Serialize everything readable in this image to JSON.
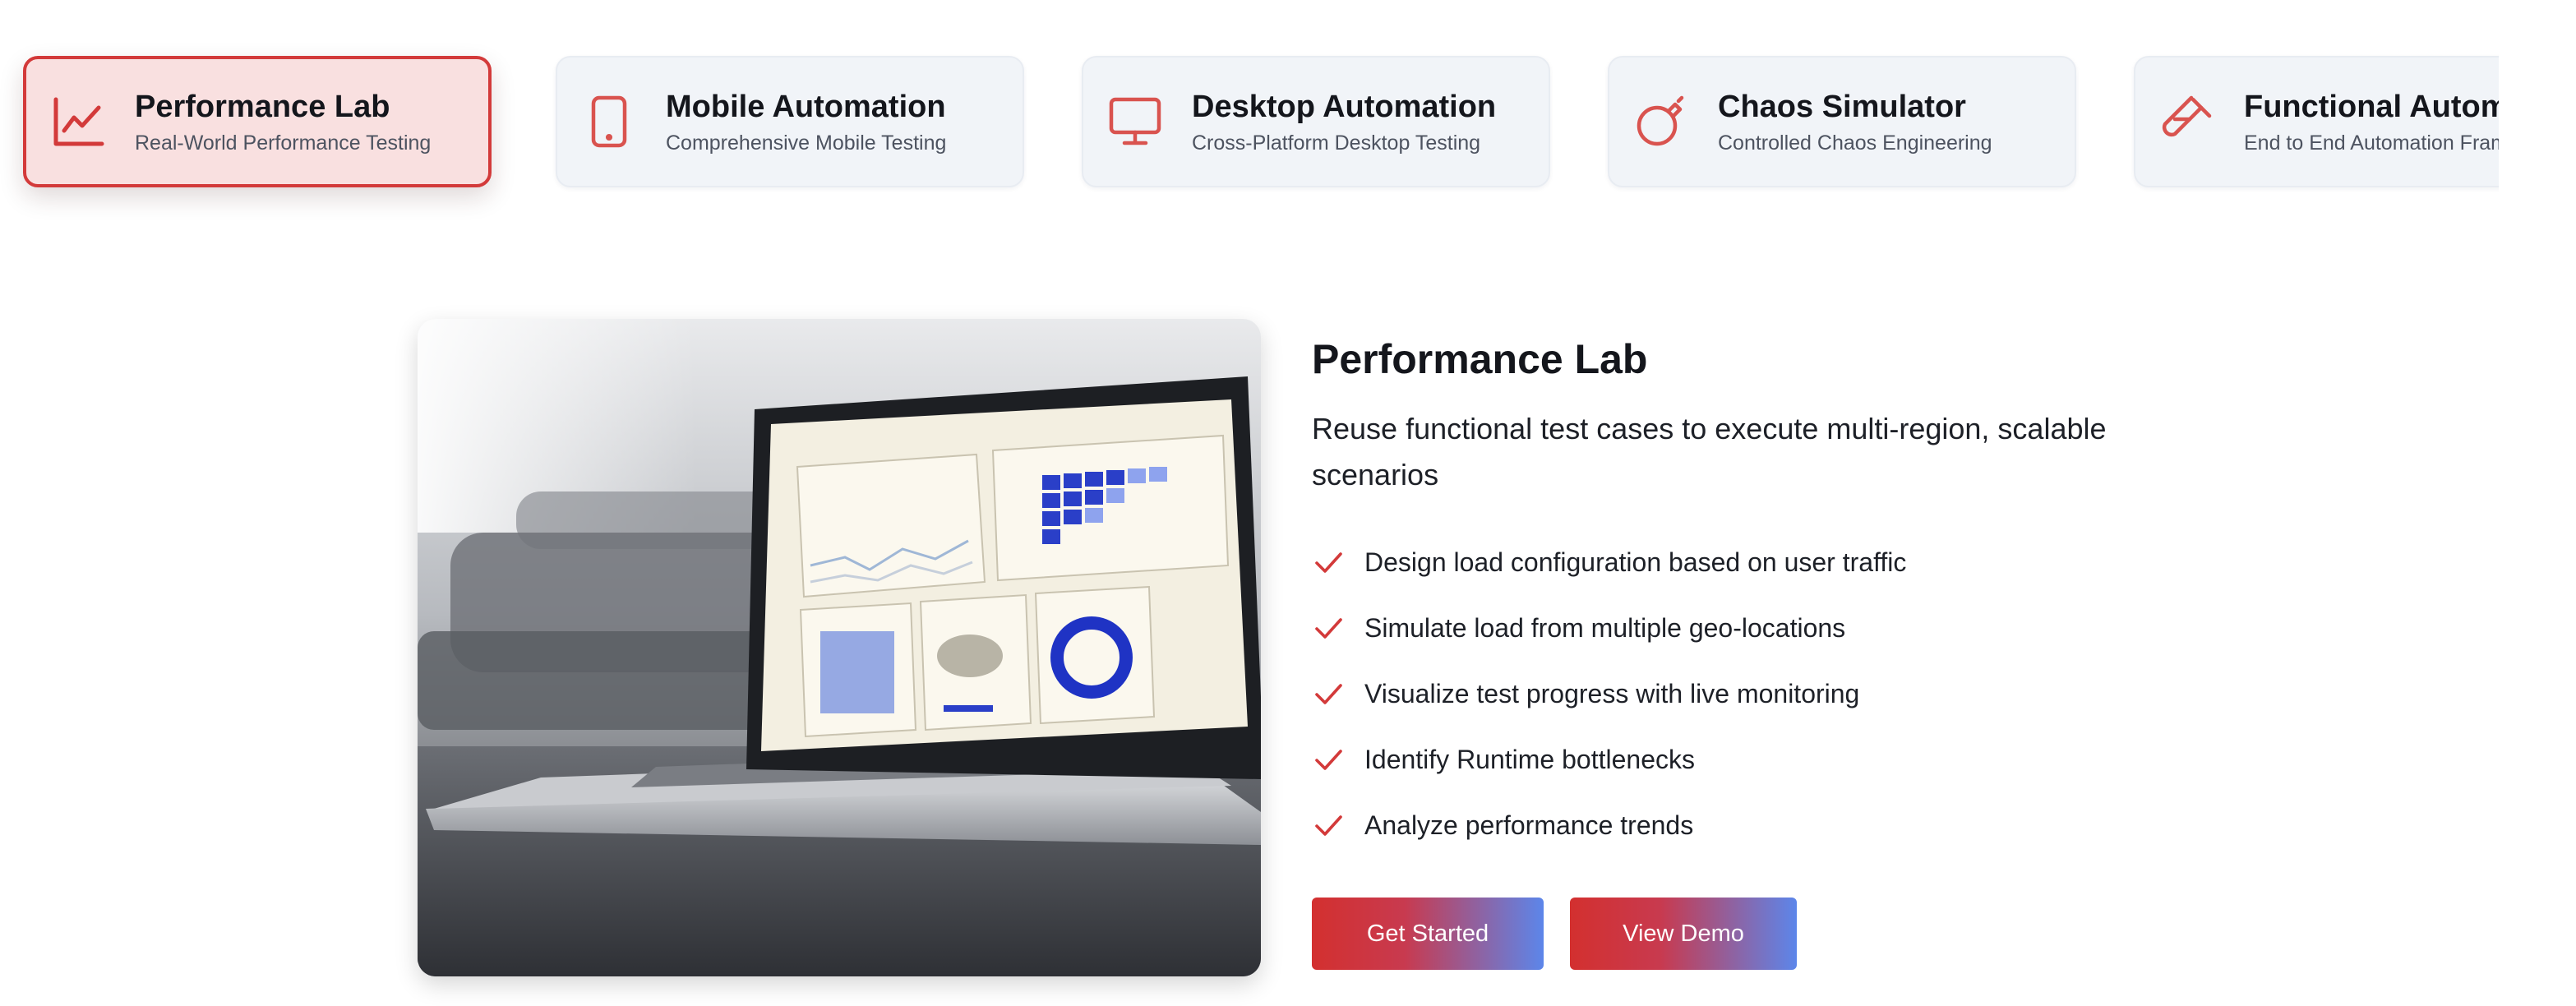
{
  "tabs": [
    {
      "title": "Performance Lab",
      "subtitle": "Real-World Performance Testing",
      "icon": "chart-line-icon",
      "active": true
    },
    {
      "title": "Mobile Automation",
      "subtitle": "Comprehensive Mobile Testing",
      "icon": "mobile-phone-icon",
      "active": false
    },
    {
      "title": "Desktop Automation",
      "subtitle": "Cross-Platform Desktop Testing",
      "icon": "monitor-icon",
      "active": false
    },
    {
      "title": "Chaos Simulator",
      "subtitle": "Controlled Chaos Engineering",
      "icon": "bomb-icon",
      "active": false
    },
    {
      "title": "Functional Automat",
      "subtitle": "End to End Automation Fram",
      "icon": "test-tube-icon",
      "active": false
    }
  ],
  "hero": {
    "image": "laptop-dashboard-photo"
  },
  "detail": {
    "title": "Performance Lab",
    "lead": "Reuse functional test cases to execute multi-region, scalable scenarios",
    "features": [
      "Design load configuration based on user traffic",
      "Simulate load from multiple geo-locations",
      "Visualize test progress with live monitoring",
      "Identify Runtime bottlenecks",
      "Analyze performance trends"
    ],
    "feature_icon": "check-icon"
  },
  "buttons": {
    "primary": "Get Started",
    "secondary": "View Demo"
  },
  "colors": {
    "accent": "#d33a3a",
    "active_tab_bg": "#f9e0e0",
    "tab_bg": "#f1f4f8",
    "button_gradient_start": "#d3302f",
    "button_gradient_end": "#5c86ea"
  }
}
